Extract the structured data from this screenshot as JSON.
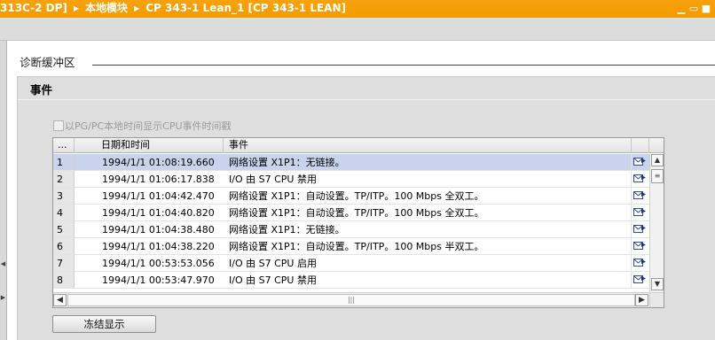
{
  "title_bar": {
    "breadcrumbs": [
      "313C-2 DP]",
      "本地模块",
      "CP 343-1 Lean_1 [CP 343-1 LEAN]"
    ],
    "controls": [
      "minimize-icon",
      "restore-icon",
      "close-icon"
    ]
  },
  "section": {
    "label": "诊断缓冲区"
  },
  "panel": {
    "title": "事件",
    "checkbox_label": "以PG/PC本地时间显示CPU事件时间戳",
    "checkbox_checked": false,
    "checkbox_enabled": false
  },
  "table": {
    "columns": [
      "...",
      "日期和时间",
      "事件"
    ],
    "selected_row": 1,
    "rows": [
      {
        "no": "1",
        "datetime": "1994/1/1 01:08:19.660",
        "event": "网络设置 X1P1：无链接。"
      },
      {
        "no": "2",
        "datetime": "1994/1/1 01:06:17.838",
        "event": "I/O 由 S7 CPU 禁用"
      },
      {
        "no": "3",
        "datetime": "1994/1/1 01:04:42.470",
        "event": "网络设置 X1P1：自动设置。TP/ITP。100 Mbps 全双工。"
      },
      {
        "no": "4",
        "datetime": "1994/1/1 01:04:40.820",
        "event": "网络设置 X1P1：自动设置。TP/ITP。100 Mbps 全双工。"
      },
      {
        "no": "5",
        "datetime": "1994/1/1 01:04:38.480",
        "event": "网络设置 X1P1：无链接。"
      },
      {
        "no": "6",
        "datetime": "1994/1/1 01:04:38.220",
        "event": "网络设置 X1P1：自动设置。TP/ITP。100 Mbps 半双工。"
      },
      {
        "no": "7",
        "datetime": "1994/1/1 00:53:53.056",
        "event": "I/O 由 S7 CPU 启用"
      },
      {
        "no": "8",
        "datetime": "1994/1/1 00:53:47.970",
        "event": "I/O 由 S7 CPU 禁用"
      }
    ],
    "row_icon": "go-to-details-icon"
  },
  "buttons": {
    "freeze": "冻结显示"
  },
  "colors": {
    "title_bar": "#f49a00",
    "selected_row": "#c9d4ec",
    "panel_bg": "#dedede"
  }
}
